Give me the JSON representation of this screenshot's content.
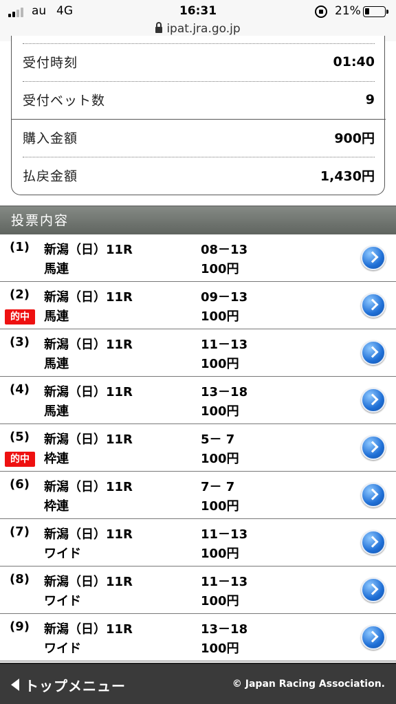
{
  "status_bar": {
    "carrier": "au",
    "network": "4G",
    "time": "16:31",
    "battery_percent": "21%",
    "battery_level": 0.21,
    "url": "ipat.jra.go.jp"
  },
  "summary": {
    "rows": [
      {
        "label": "受付時刻",
        "value": "01:40"
      },
      {
        "label": "受付ベット数",
        "value": "9"
      },
      {
        "label": "購入金額",
        "value": "900円"
      },
      {
        "label": "払戻金額",
        "value": "1,430円"
      }
    ]
  },
  "section": {
    "title": "投票内容"
  },
  "hit_label": "的中",
  "bets": [
    {
      "num": "(1)",
      "race": "新潟（日）11R",
      "type": "馬連",
      "combo": "08－13",
      "amount": "100円",
      "hit": false
    },
    {
      "num": "(2)",
      "race": "新潟（日）11R",
      "type": "馬連",
      "combo": "09－13",
      "amount": "100円",
      "hit": true
    },
    {
      "num": "(3)",
      "race": "新潟（日）11R",
      "type": "馬連",
      "combo": "11－13",
      "amount": "100円",
      "hit": false
    },
    {
      "num": "(4)",
      "race": "新潟（日）11R",
      "type": "馬連",
      "combo": "13－18",
      "amount": "100円",
      "hit": false
    },
    {
      "num": "(5)",
      "race": "新潟（日）11R",
      "type": "枠連",
      "combo": "5－ 7",
      "amount": "100円",
      "hit": true
    },
    {
      "num": "(6)",
      "race": "新潟（日）11R",
      "type": "枠連",
      "combo": "7－ 7",
      "amount": "100円",
      "hit": false
    },
    {
      "num": "(7)",
      "race": "新潟（日）11R",
      "type": "ワイド",
      "combo": "11－13",
      "amount": "100円",
      "hit": false
    },
    {
      "num": "(8)",
      "race": "新潟（日）11R",
      "type": "ワイド",
      "combo": "11－13",
      "amount": "100円",
      "hit": false
    },
    {
      "num": "(9)",
      "race": "新潟（日）11R",
      "type": "ワイド",
      "combo": "13－18",
      "amount": "100円",
      "hit": false
    }
  ],
  "footer": {
    "top_menu": "トップメニュー",
    "copyright": "© Japan Racing Association."
  }
}
